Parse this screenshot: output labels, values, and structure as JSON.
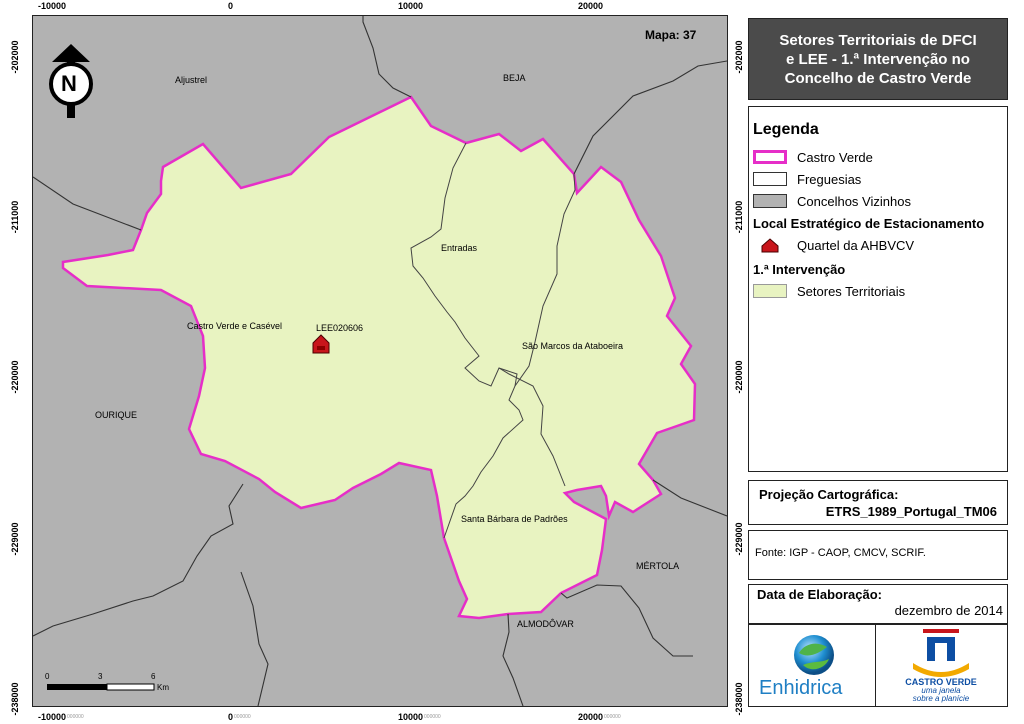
{
  "map": {
    "mapa_label": "Mapa: 37",
    "north_label": "N",
    "x_ticks": [
      "-10000",
      "0",
      "10000",
      "20000"
    ],
    "y_ticks": [
      "-202000",
      "-211000",
      "-220000",
      "-229000",
      "-238000"
    ],
    "coord_suffix": "000000",
    "places": {
      "aljustrel": "Aljustrel",
      "beja": "BEJA",
      "entradas": "Entradas",
      "castro_verde_casevel": "Castro Verde e Casével",
      "lee_code": "LEE020606",
      "sao_marcos": "São Marcos da Ataboeira",
      "ourique": "OURIQUE",
      "santa_barbara": "Santa Bárbara de Padrões",
      "mertola": "MÉRTOLA",
      "almodovar": "ALMODÔVAR"
    },
    "scale": {
      "ticks": [
        "0",
        "3",
        "6"
      ],
      "unit": "Km"
    },
    "colors": {
      "background": "#b2b2b2",
      "sector_fill": "#e8f3c1",
      "boundary": "#e62ec8",
      "parish_line": "#333333",
      "marker": "#c8151b"
    }
  },
  "title": {
    "line1": "Setores Territoriais de DFCI",
    "line2": "e LEE - 1.ª Intervenção no",
    "line3": "Concelho de Castro Verde"
  },
  "legend": {
    "title": "Legenda",
    "items": [
      {
        "label": "Castro Verde",
        "swatch": "pink-outline"
      },
      {
        "label": "Freguesias",
        "swatch": "white-box"
      },
      {
        "label": "Concelhos Vizinhos",
        "swatch": "grey-box"
      }
    ],
    "lee_heading": "Local Estratégico de Estacionamento",
    "lee_item": "Quartel da AHBVCV",
    "intervention_heading": "1.ª Intervenção",
    "intervention_item": "Setores Territoriais"
  },
  "projection": {
    "label": "Projeção Cartográfica:",
    "value": "ETRS_1989_Portugal_TM06"
  },
  "source": {
    "text": "Fonte: IGP - CAOP, CMCV, SCRIF."
  },
  "date": {
    "label": "Data de Elaboração:",
    "value": "dezembro de 2014"
  },
  "logos": {
    "enhidrica": "Enhidrica",
    "castro_verde": "CASTRO VERDE",
    "castro_verde_tag1": "uma janela",
    "castro_verde_tag2": "sobre a planície"
  }
}
